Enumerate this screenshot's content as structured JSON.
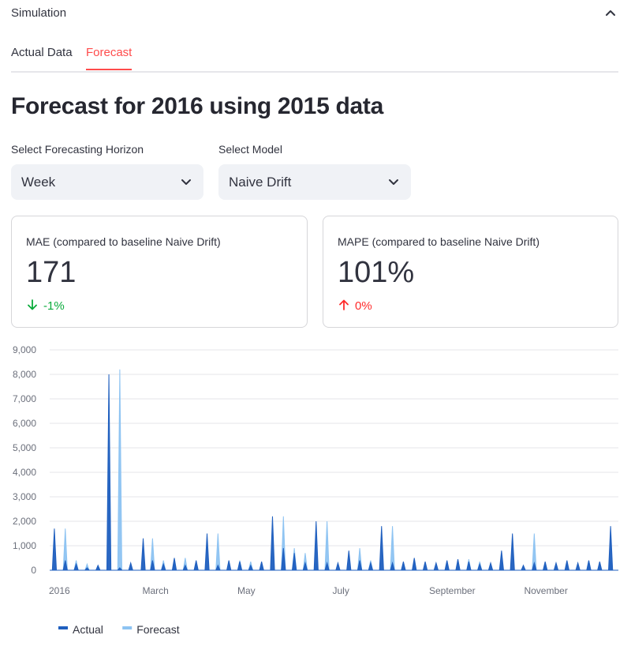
{
  "expander": {
    "title": "Simulation"
  },
  "tabs": [
    {
      "label": "Actual Data",
      "active": false
    },
    {
      "label": "Forecast",
      "active": true
    }
  ],
  "page_title": "Forecast for 2016 using 2015 data",
  "horizon_select": {
    "label": "Select Forecasting Horizon",
    "value": "Week"
  },
  "model_select": {
    "label": "Select Model",
    "value": "Naive Drift"
  },
  "metrics": [
    {
      "label": "MAE (compared to baseline Naive Drift)",
      "value": "171",
      "delta": "-1%",
      "delta_direction": "down",
      "delta_color": "#09ab3b"
    },
    {
      "label": "MAPE (compared to baseline Naive Drift)",
      "value": "101%",
      "delta": "0%",
      "delta_direction": "up",
      "delta_color": "#ff2b2b"
    }
  ],
  "colors": {
    "accent": "#ff4b4b",
    "actual": "#1f5fbf",
    "forecast": "#8dc3f2"
  },
  "chart_data": {
    "type": "area",
    "x_axis_type": "date",
    "x_ticks": [
      "2016",
      "March",
      "May",
      "July",
      "September",
      "November"
    ],
    "x_tick_dates": [
      "2016-01-01",
      "2016-03-01",
      "2016-05-01",
      "2016-07-01",
      "2016-09-01",
      "2016-11-01"
    ],
    "x_range": [
      "2016-01-01",
      "2016-12-31"
    ],
    "ylim": [
      0,
      9000
    ],
    "y_ticks": [
      "0",
      "1,000",
      "2,000",
      "3,000",
      "4,000",
      "5,000",
      "6,000",
      "7,000",
      "8,000",
      "9,000"
    ],
    "y_tick_values": [
      0,
      1000,
      2000,
      3000,
      4000,
      5000,
      6000,
      7000,
      8000,
      9000
    ],
    "grid": true,
    "legend_position": "bottom-left",
    "series": [
      {
        "name": "Actual",
        "color": "#1f5fbf",
        "points": [
          [
            "2016-01-04",
            1700
          ],
          [
            "2016-01-11",
            400
          ],
          [
            "2016-01-18",
            250
          ],
          [
            "2016-01-25",
            100
          ],
          [
            "2016-02-01",
            200
          ],
          [
            "2016-02-08",
            8000
          ],
          [
            "2016-02-15",
            100
          ],
          [
            "2016-02-22",
            300
          ],
          [
            "2016-03-01",
            1300
          ],
          [
            "2016-03-07",
            400
          ],
          [
            "2016-03-14",
            250
          ],
          [
            "2016-03-21",
            500
          ],
          [
            "2016-03-28",
            200
          ],
          [
            "2016-04-04",
            400
          ],
          [
            "2016-04-11",
            1500
          ],
          [
            "2016-04-18",
            200
          ],
          [
            "2016-04-25",
            400
          ],
          [
            "2016-05-02",
            350
          ],
          [
            "2016-05-09",
            200
          ],
          [
            "2016-05-16",
            350
          ],
          [
            "2016-05-23",
            2200
          ],
          [
            "2016-05-30",
            900
          ],
          [
            "2016-06-06",
            700
          ],
          [
            "2016-06-13",
            300
          ],
          [
            "2016-06-20",
            2000
          ],
          [
            "2016-06-27",
            300
          ],
          [
            "2016-07-04",
            300
          ],
          [
            "2016-07-11",
            800
          ],
          [
            "2016-07-18",
            400
          ],
          [
            "2016-07-25",
            300
          ],
          [
            "2016-08-01",
            1800
          ],
          [
            "2016-08-08",
            300
          ],
          [
            "2016-08-15",
            350
          ],
          [
            "2016-08-22",
            500
          ],
          [
            "2016-08-29",
            350
          ],
          [
            "2016-09-05",
            300
          ],
          [
            "2016-09-12",
            400
          ],
          [
            "2016-09-19",
            450
          ],
          [
            "2016-09-26",
            350
          ],
          [
            "2016-10-03",
            250
          ],
          [
            "2016-10-10",
            300
          ],
          [
            "2016-10-17",
            800
          ],
          [
            "2016-10-24",
            1500
          ],
          [
            "2016-10-31",
            200
          ],
          [
            "2016-11-07",
            300
          ],
          [
            "2016-11-14",
            350
          ],
          [
            "2016-11-21",
            300
          ],
          [
            "2016-11-28",
            400
          ],
          [
            "2016-12-05",
            300
          ],
          [
            "2016-12-12",
            400
          ],
          [
            "2016-12-19",
            350
          ],
          [
            "2016-12-26",
            1800
          ]
        ]
      },
      {
        "name": "Forecast",
        "color": "#8dc3f2",
        "points": [
          [
            "2016-01-11",
            1700
          ],
          [
            "2016-01-18",
            400
          ],
          [
            "2016-01-25",
            250
          ],
          [
            "2016-02-01",
            100
          ],
          [
            "2016-02-15",
            8200
          ],
          [
            "2016-02-22",
            100
          ],
          [
            "2016-03-07",
            1300
          ],
          [
            "2016-03-14",
            400
          ],
          [
            "2016-03-21",
            250
          ],
          [
            "2016-03-28",
            500
          ],
          [
            "2016-04-04",
            200
          ],
          [
            "2016-04-18",
            1500
          ],
          [
            "2016-05-02",
            400
          ],
          [
            "2016-05-09",
            350
          ],
          [
            "2016-05-16",
            200
          ],
          [
            "2016-05-30",
            2200
          ],
          [
            "2016-06-06",
            900
          ],
          [
            "2016-06-13",
            700
          ],
          [
            "2016-06-20",
            300
          ],
          [
            "2016-06-27",
            2000
          ],
          [
            "2016-07-18",
            900
          ],
          [
            "2016-07-25",
            400
          ],
          [
            "2016-08-08",
            1800
          ],
          [
            "2016-08-15",
            300
          ],
          [
            "2016-08-22",
            350
          ],
          [
            "2016-09-12",
            300
          ],
          [
            "2016-09-19",
            400
          ],
          [
            "2016-09-26",
            450
          ],
          [
            "2016-10-03",
            350
          ],
          [
            "2016-10-10",
            250
          ],
          [
            "2016-10-17",
            300
          ],
          [
            "2016-11-07",
            1500
          ],
          [
            "2016-11-14",
            200
          ],
          [
            "2016-11-28",
            350
          ],
          [
            "2016-12-12",
            400
          ],
          [
            "2016-12-19",
            300
          ],
          [
            "2016-12-26",
            400
          ]
        ]
      }
    ]
  }
}
